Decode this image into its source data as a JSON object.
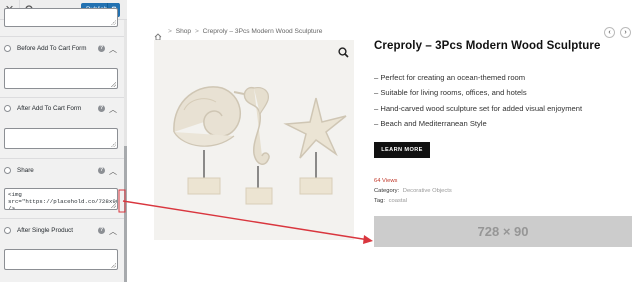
{
  "customizer": {
    "close_icon": "✕",
    "search_icon": "search-icon",
    "publish_label": "Publish",
    "gear_icon": "⚙",
    "sections": [
      {
        "label": "Before Add To Cart Form",
        "help": "?",
        "caret": "︿"
      },
      {
        "label": "After Add To Cart Form",
        "help": "?",
        "caret": "︿"
      },
      {
        "label": "Share",
        "help": "?",
        "caret": "︿"
      },
      {
        "label": "After Single Product",
        "help": "?",
        "caret": "︿"
      }
    ],
    "share_code": "<img src=\"https://placehold.co/728x90\" />"
  },
  "preview": {
    "breadcrumb": {
      "home_icon": "home-icon",
      "items": [
        "Shop",
        "Creproly – 3Pcs Modern Wood Sculpture"
      ],
      "separator": ">"
    },
    "prev_arrow": "‹",
    "next_arrow": "›",
    "zoom_icon": "magnifier-icon",
    "product": {
      "title": "Creproly – 3Pcs Modern Wood Sculpture",
      "bullets": [
        "– Perfect for creating an ocean-themed room",
        "– Suitable for living rooms, offices, and hotels",
        "– Hand-carved wood sculpture set for added visual enjoyment",
        "– Beach and Mediterranean Style"
      ],
      "button_label": "LEARN MORE",
      "views": "64 Views",
      "category_label": "Category:",
      "category_value": "Decorative Objects",
      "tag_label": "Tag:",
      "tag_value": "coastal"
    },
    "ad_text": "728 × 90"
  },
  "colors": {
    "accent": "#2271b1",
    "arrow": "#d9363e",
    "views": "#c0392b"
  }
}
